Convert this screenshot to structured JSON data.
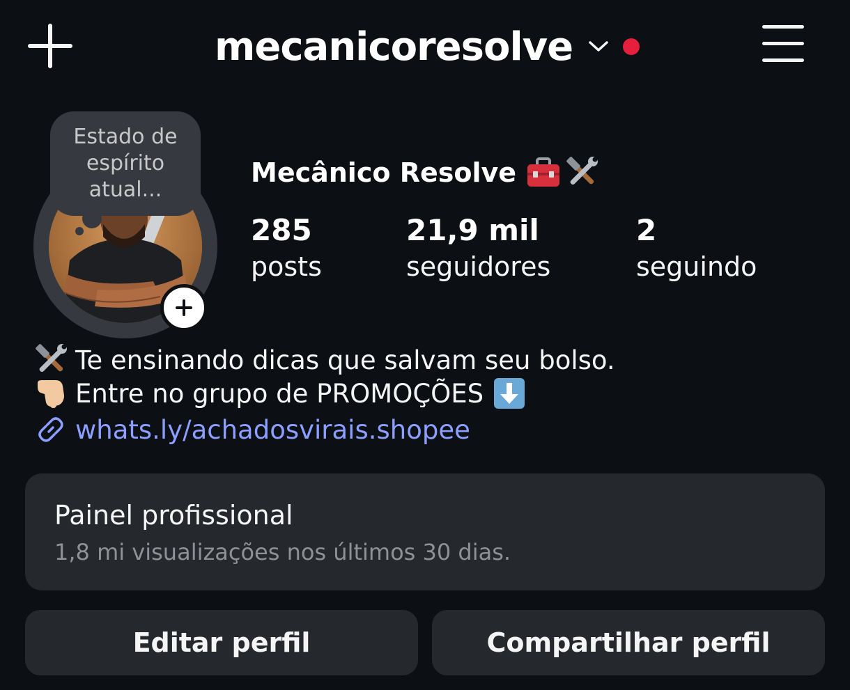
{
  "header": {
    "username": "mecanicoresolve",
    "notification_dot_color": "#e61f3c"
  },
  "note": {
    "text": "Estado de espírito atual..."
  },
  "profile": {
    "display_name": "Mecânico Resolve",
    "name_emojis": [
      "toolbox",
      "hammer-and-wrench"
    ]
  },
  "stats": [
    {
      "count": "285",
      "label": "posts"
    },
    {
      "count": "21,9 mil",
      "label": "seguidores"
    },
    {
      "count": "2",
      "label": "seguindo"
    }
  ],
  "bio": {
    "lines": [
      {
        "emoji": "hammer-and-wrench",
        "text": "Te ensinando dicas que salvam seu bolso."
      },
      {
        "emoji": "pointing-down-hand",
        "text": "Entre no grupo de PROMOÇÕES"
      }
    ],
    "line2_trailing_emoji": "down-arrow",
    "link": "whats.ly/achadosvirais.shopee",
    "link_color": "#8c9fff"
  },
  "dashboard": {
    "title": "Painel profissional",
    "subtitle": "1,8 mi visualizações nos últimos 30 dias."
  },
  "buttons": {
    "edit_profile": "Editar perfil",
    "share_profile": "Compartilhar perfil"
  },
  "colors": {
    "background": "#0c1014",
    "card": "#25292e",
    "text": "#f5f5f5",
    "muted": "#8e9296"
  }
}
